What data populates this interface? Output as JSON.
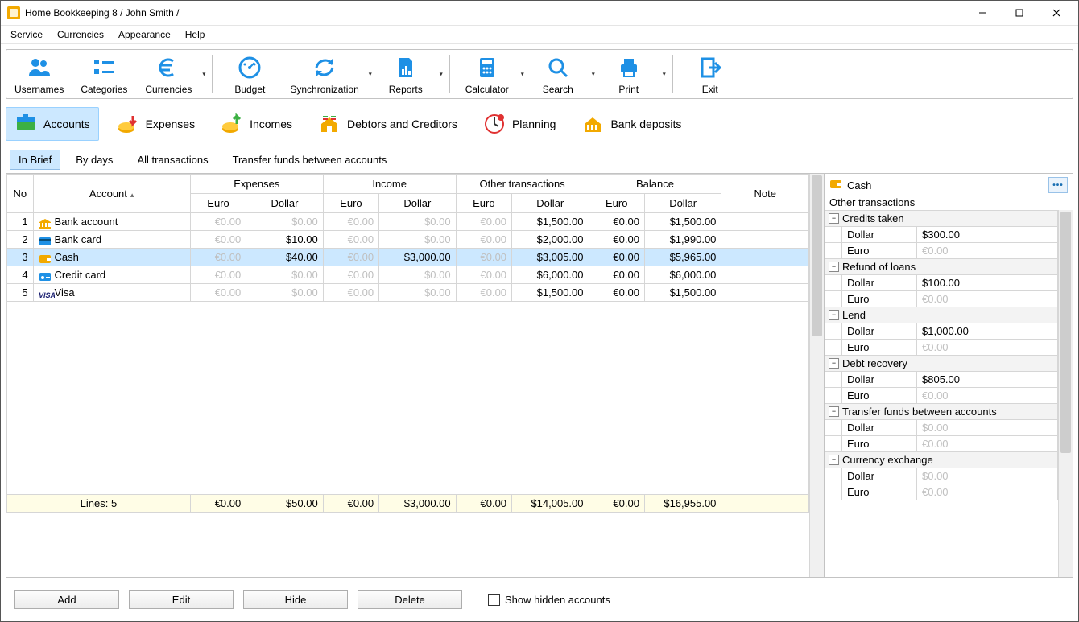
{
  "window": {
    "title": "Home Bookkeeping 8  / John Smith /"
  },
  "menu": [
    "Service",
    "Currencies",
    "Appearance",
    "Help"
  ],
  "toolbar": [
    {
      "label": "Usernames"
    },
    {
      "label": "Categories"
    },
    {
      "label": "Currencies",
      "dropdown": true
    },
    {
      "sep": true
    },
    {
      "label": "Budget"
    },
    {
      "label": "Synchronization",
      "dropdown": true
    },
    {
      "label": "Reports",
      "dropdown": true
    },
    {
      "sep": true
    },
    {
      "label": "Calculator",
      "dropdown": true
    },
    {
      "label": "Search",
      "dropdown": true
    },
    {
      "label": "Print",
      "dropdown": true
    },
    {
      "sep": true
    },
    {
      "label": "Exit"
    }
  ],
  "sections": [
    {
      "label": "Accounts",
      "active": true
    },
    {
      "label": "Expenses"
    },
    {
      "label": "Incomes"
    },
    {
      "label": "Debtors and Creditors"
    },
    {
      "label": "Planning"
    },
    {
      "label": "Bank deposits"
    }
  ],
  "subtabs": [
    {
      "label": "In Brief",
      "active": true
    },
    {
      "label": "By days"
    },
    {
      "label": "All transactions"
    },
    {
      "label": "Transfer funds between accounts"
    }
  ],
  "grid": {
    "headers_top": [
      "No",
      "Account",
      "Expenses",
      "Income",
      "Other transactions",
      "Balance",
      "Note"
    ],
    "headers_sub": [
      "Euro",
      "Dollar",
      "Euro",
      "Dollar",
      "Euro",
      "Dollar",
      "Euro",
      "Dollar"
    ],
    "rows": [
      {
        "no": "1",
        "account": "Bank account",
        "icon": "bank",
        "exp_eur": "€0.00",
        "exp_usd": "$0.00",
        "inc_eur": "€0.00",
        "inc_usd": "$0.00",
        "oth_eur": "€0.00",
        "oth_usd": "$1,500.00",
        "bal_eur": "€0.00",
        "bal_usd": "$1,500.00",
        "faded": {
          "exp_eur": true,
          "exp_usd": true,
          "inc_eur": true,
          "inc_usd": true,
          "oth_eur": true
        }
      },
      {
        "no": "2",
        "account": "Bank card",
        "icon": "card",
        "exp_eur": "€0.00",
        "exp_usd": "$10.00",
        "inc_eur": "€0.00",
        "inc_usd": "$0.00",
        "oth_eur": "€0.00",
        "oth_usd": "$2,000.00",
        "bal_eur": "€0.00",
        "bal_usd": "$1,990.00",
        "faded": {
          "exp_eur": true,
          "inc_eur": true,
          "inc_usd": true,
          "oth_eur": true
        }
      },
      {
        "no": "3",
        "account": "Cash",
        "icon": "wallet",
        "selected": true,
        "exp_eur": "€0.00",
        "exp_usd": "$40.00",
        "inc_eur": "€0.00",
        "inc_usd": "$3,000.00",
        "oth_eur": "€0.00",
        "oth_usd": "$3,005.00",
        "bal_eur": "€0.00",
        "bal_usd": "$5,965.00",
        "faded": {
          "exp_eur": true,
          "inc_eur": true,
          "oth_eur": true
        }
      },
      {
        "no": "4",
        "account": "Credit card",
        "icon": "credit",
        "exp_eur": "€0.00",
        "exp_usd": "$0.00",
        "inc_eur": "€0.00",
        "inc_usd": "$0.00",
        "oth_eur": "€0.00",
        "oth_usd": "$6,000.00",
        "bal_eur": "€0.00",
        "bal_usd": "$6,000.00",
        "faded": {
          "exp_eur": true,
          "exp_usd": true,
          "inc_eur": true,
          "inc_usd": true,
          "oth_eur": true
        }
      },
      {
        "no": "5",
        "account": "Visa",
        "icon": "visa",
        "exp_eur": "€0.00",
        "exp_usd": "$0.00",
        "inc_eur": "€0.00",
        "inc_usd": "$0.00",
        "oth_eur": "€0.00",
        "oth_usd": "$1,500.00",
        "bal_eur": "€0.00",
        "bal_usd": "$1,500.00",
        "faded": {
          "exp_eur": true,
          "exp_usd": true,
          "inc_eur": true,
          "inc_usd": true,
          "oth_eur": true
        }
      }
    ],
    "totals": {
      "label": "Lines: 5",
      "exp_eur": "€0.00",
      "exp_usd": "$50.00",
      "inc_eur": "€0.00",
      "inc_usd": "$3,000.00",
      "oth_eur": "€0.00",
      "oth_usd": "$14,005.00",
      "bal_eur": "€0.00",
      "bal_usd": "$16,955.00"
    }
  },
  "side": {
    "title": "Cash",
    "subtitle": "Other transactions",
    "groups": [
      {
        "name": "Credits taken",
        "rows": [
          {
            "k": "Dollar",
            "v": "$300.00"
          },
          {
            "k": "Euro",
            "v": "€0.00",
            "faded": true
          }
        ]
      },
      {
        "name": "Refund of loans",
        "rows": [
          {
            "k": "Dollar",
            "v": "$100.00"
          },
          {
            "k": "Euro",
            "v": "€0.00",
            "faded": true
          }
        ]
      },
      {
        "name": "Lend",
        "rows": [
          {
            "k": "Dollar",
            "v": "$1,000.00"
          },
          {
            "k": "Euro",
            "v": "€0.00",
            "faded": true
          }
        ]
      },
      {
        "name": "Debt recovery",
        "rows": [
          {
            "k": "Dollar",
            "v": "$805.00"
          },
          {
            "k": "Euro",
            "v": "€0.00",
            "faded": true
          }
        ]
      },
      {
        "name": "Transfer funds between accounts",
        "rows": [
          {
            "k": "Dollar",
            "v": "$0.00",
            "faded": true
          },
          {
            "k": "Euro",
            "v": "€0.00",
            "faded": true
          }
        ]
      },
      {
        "name": "Currency exchange",
        "rows": [
          {
            "k": "Dollar",
            "v": "$0.00",
            "faded": true
          },
          {
            "k": "Euro",
            "v": "€0.00",
            "faded": true
          }
        ]
      }
    ]
  },
  "actions": {
    "add": "Add",
    "edit": "Edit",
    "hide": "Hide",
    "delete": "Delete",
    "show_hidden": "Show hidden accounts"
  }
}
